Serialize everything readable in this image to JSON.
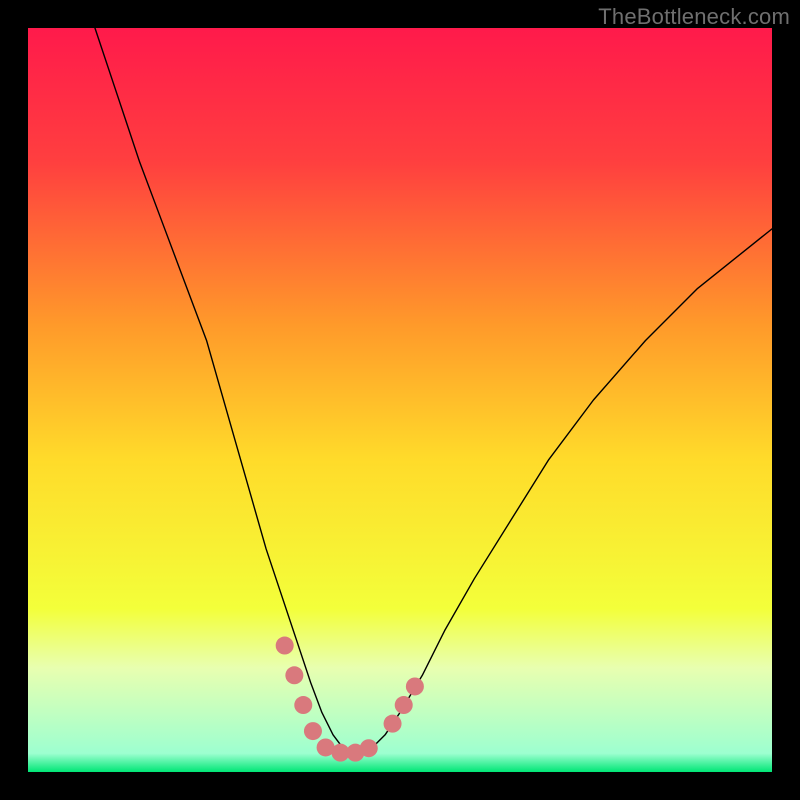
{
  "watermark": "TheBottleneck.com",
  "chart_data": {
    "type": "line",
    "title": "",
    "xlabel": "",
    "ylabel": "",
    "xlim": [
      0,
      100
    ],
    "ylim": [
      0,
      100
    ],
    "background_gradient": {
      "stops": [
        {
          "offset": 0.0,
          "color": "#ff1a4b"
        },
        {
          "offset": 0.18,
          "color": "#ff3f3f"
        },
        {
          "offset": 0.4,
          "color": "#ff9a2a"
        },
        {
          "offset": 0.58,
          "color": "#ffdb2a"
        },
        {
          "offset": 0.78,
          "color": "#f3ff3a"
        },
        {
          "offset": 0.86,
          "color": "#e8ffb0"
        },
        {
          "offset": 0.975,
          "color": "#9dffd0"
        },
        {
          "offset": 1.0,
          "color": "#00e676"
        }
      ]
    },
    "series": [
      {
        "name": "bottleneck-curve",
        "x": [
          9,
          12,
          15,
          18,
          21,
          24,
          26,
          28,
          30,
          32,
          34,
          36,
          38,
          39.5,
          41,
          42.5,
          44,
          46,
          48,
          50,
          53,
          56,
          60,
          65,
          70,
          76,
          83,
          90,
          100
        ],
        "y": [
          100,
          91,
          82,
          74,
          66,
          58,
          51,
          44,
          37,
          30,
          24,
          18,
          12,
          8,
          5,
          3,
          2.5,
          3,
          5,
          8,
          13,
          19,
          26,
          34,
          42,
          50,
          58,
          65,
          73
        ],
        "stroke": "#000000",
        "stroke_width": 1.4
      }
    ],
    "markers": {
      "name": "highlight-dots",
      "color": "#d9797d",
      "radius": 9,
      "points": [
        {
          "x": 34.5,
          "y": 17
        },
        {
          "x": 35.8,
          "y": 13
        },
        {
          "x": 37.0,
          "y": 9
        },
        {
          "x": 38.3,
          "y": 5.5
        },
        {
          "x": 40.0,
          "y": 3.3
        },
        {
          "x": 42.0,
          "y": 2.6
        },
        {
          "x": 44.0,
          "y": 2.6
        },
        {
          "x": 45.8,
          "y": 3.2
        },
        {
          "x": 49.0,
          "y": 6.5
        },
        {
          "x": 50.5,
          "y": 9.0
        },
        {
          "x": 52.0,
          "y": 11.5
        }
      ]
    }
  }
}
